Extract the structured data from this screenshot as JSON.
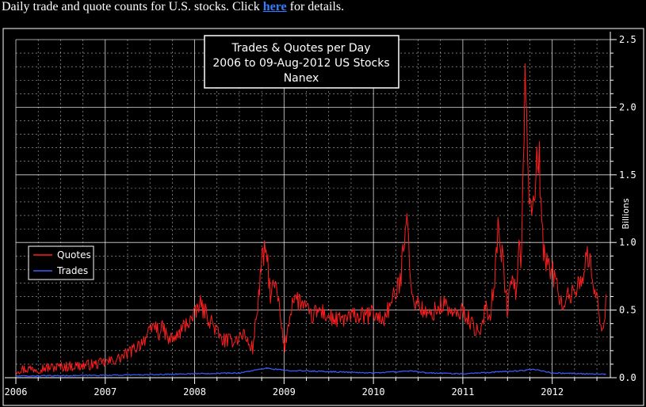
{
  "caption": {
    "prefix": "Daily trade and quote counts for U.S. stocks. Click ",
    "link": "here",
    "suffix": " for details."
  },
  "colors": {
    "background": "#000000",
    "frame": "#ffffff",
    "grid": "#ffffff",
    "quotes": "#ff1e1e",
    "trades": "#3a5cff",
    "caption_link": "#2f7fff"
  },
  "chart_data": {
    "type": "line",
    "title": [
      "Trades & Quotes per Day",
      "2006 to 09-Aug-2012 US Stocks",
      "Nanex"
    ],
    "ylabel": "Billions",
    "xlabel": "",
    "x_ticks": [
      "2006",
      "2007",
      "2008",
      "2009",
      "2010",
      "2011",
      "2012"
    ],
    "xlim": [
      2006.0,
      2012.65
    ],
    "y_ticks": [
      "0.0",
      "0.5",
      "1.0",
      "1.5",
      "2.0",
      "2.5"
    ],
    "ylim": [
      0,
      2.5
    ],
    "grid": true,
    "legend": "left",
    "series": [
      {
        "name": "Quotes",
        "color": "#ff1e1e",
        "x": [
          2006.0,
          2006.25,
          2006.5,
          2006.75,
          2006.9,
          2007.05,
          2007.15,
          2007.3,
          2007.4,
          2007.5,
          2007.55,
          2007.6,
          2007.65,
          2007.7,
          2007.8,
          2007.9,
          2008.0,
          2008.05,
          2008.1,
          2008.2,
          2008.3,
          2008.4,
          2008.5,
          2008.55,
          2008.6,
          2008.65,
          2008.7,
          2008.75,
          2008.8,
          2008.85,
          2008.9,
          2008.95,
          2009.0,
          2009.1,
          2009.2,
          2009.3,
          2009.4,
          2009.5,
          2009.6,
          2009.7,
          2009.8,
          2009.9,
          2010.0,
          2010.1,
          2010.2,
          2010.3,
          2010.35,
          2010.38,
          2010.42,
          2010.5,
          2010.6,
          2010.7,
          2010.8,
          2010.9,
          2011.0,
          2011.1,
          2011.2,
          2011.25,
          2011.3,
          2011.35,
          2011.4,
          2011.5,
          2011.55,
          2011.6,
          2011.62,
          2011.65,
          2011.7,
          2011.75,
          2011.8,
          2011.85,
          2011.9,
          2012.0,
          2012.1,
          2012.2,
          2012.3,
          2012.4,
          2012.5,
          2012.55,
          2012.6
        ],
        "values": [
          0.06,
          0.07,
          0.08,
          0.09,
          0.1,
          0.12,
          0.14,
          0.2,
          0.26,
          0.33,
          0.4,
          0.33,
          0.37,
          0.28,
          0.3,
          0.4,
          0.45,
          0.55,
          0.5,
          0.4,
          0.28,
          0.27,
          0.3,
          0.33,
          0.25,
          0.22,
          0.5,
          0.85,
          0.95,
          0.6,
          0.7,
          0.5,
          0.2,
          0.6,
          0.55,
          0.45,
          0.5,
          0.45,
          0.42,
          0.44,
          0.46,
          0.45,
          0.48,
          0.42,
          0.55,
          0.7,
          1.1,
          1.3,
          0.6,
          0.55,
          0.45,
          0.5,
          0.55,
          0.45,
          0.5,
          0.4,
          0.3,
          0.55,
          0.45,
          0.7,
          1.15,
          0.5,
          0.75,
          0.6,
          1.0,
          0.8,
          2.3,
          1.2,
          1.4,
          1.7,
          0.9,
          0.8,
          0.55,
          0.6,
          0.7,
          0.9,
          0.6,
          0.3,
          0.55
        ],
        "amplitude": 0.08
      },
      {
        "name": "Trades",
        "color": "#3a5cff",
        "x": [
          2006.0,
          2006.5,
          2007.0,
          2007.5,
          2008.0,
          2008.5,
          2008.8,
          2009.0,
          2009.5,
          2010.0,
          2010.4,
          2010.6,
          2011.0,
          2011.6,
          2011.8,
          2012.0,
          2012.6
        ],
        "values": [
          0.012,
          0.015,
          0.018,
          0.022,
          0.03,
          0.035,
          0.07,
          0.055,
          0.045,
          0.035,
          0.05,
          0.035,
          0.03,
          0.05,
          0.06,
          0.035,
          0.025
        ],
        "amplitude": 0.01
      }
    ]
  }
}
